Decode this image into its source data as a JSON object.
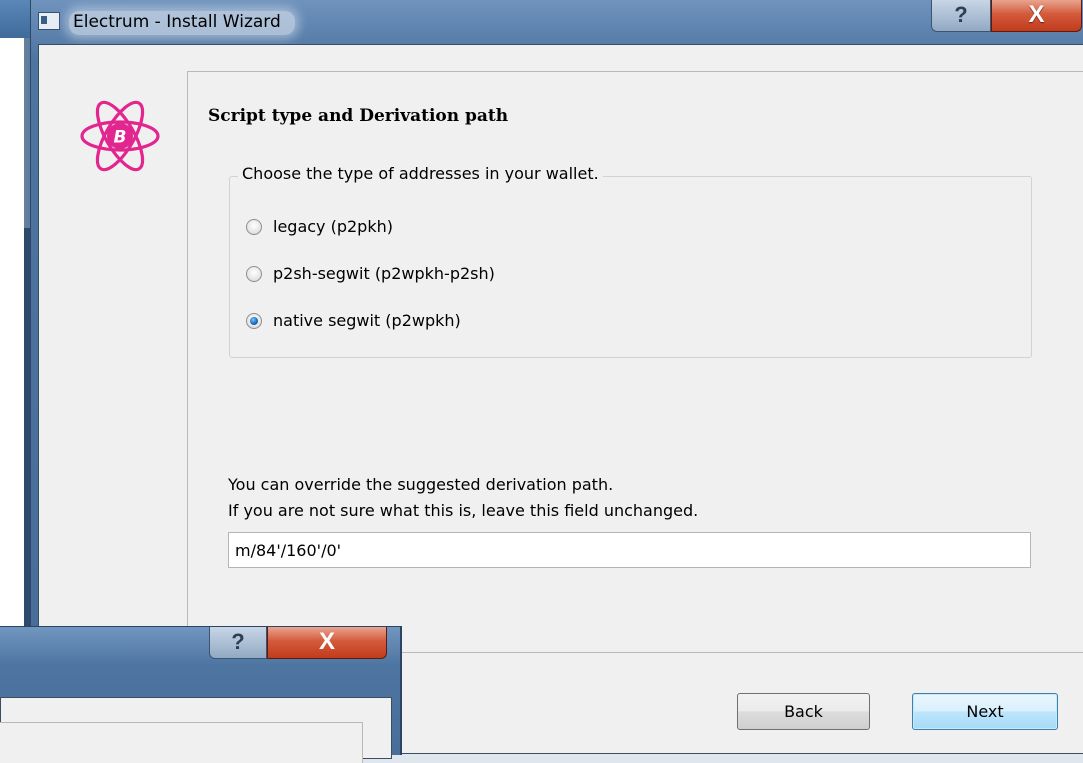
{
  "window": {
    "title": "Electrum  -  Install Wizard",
    "help_label": "?",
    "close_label": "X"
  },
  "page": {
    "heading": "Script type and Derivation path",
    "group_title": "Choose the type of addresses in your wallet.",
    "options": [
      {
        "label": "legacy (p2pkh)",
        "checked": false
      },
      {
        "label": "p2sh-segwit (p2wpkh-p2sh)",
        "checked": false
      },
      {
        "label": "native segwit (p2wpkh)",
        "checked": true
      }
    ],
    "info_line1": "You can override the suggested derivation path.",
    "info_line2": "If you are not sure what this is, leave this field unchanged.",
    "derivation_path": "m/84'/160'/0'"
  },
  "buttons": {
    "back": "Back",
    "next": "Next"
  },
  "second_window": {
    "help_label": "?",
    "close_label": "X"
  },
  "colors": {
    "logo": "#e2258f",
    "accent": "#3c7fb1"
  },
  "icons": [
    "electrum-logo-icon",
    "app-icon",
    "help-icon",
    "close-icon"
  ]
}
